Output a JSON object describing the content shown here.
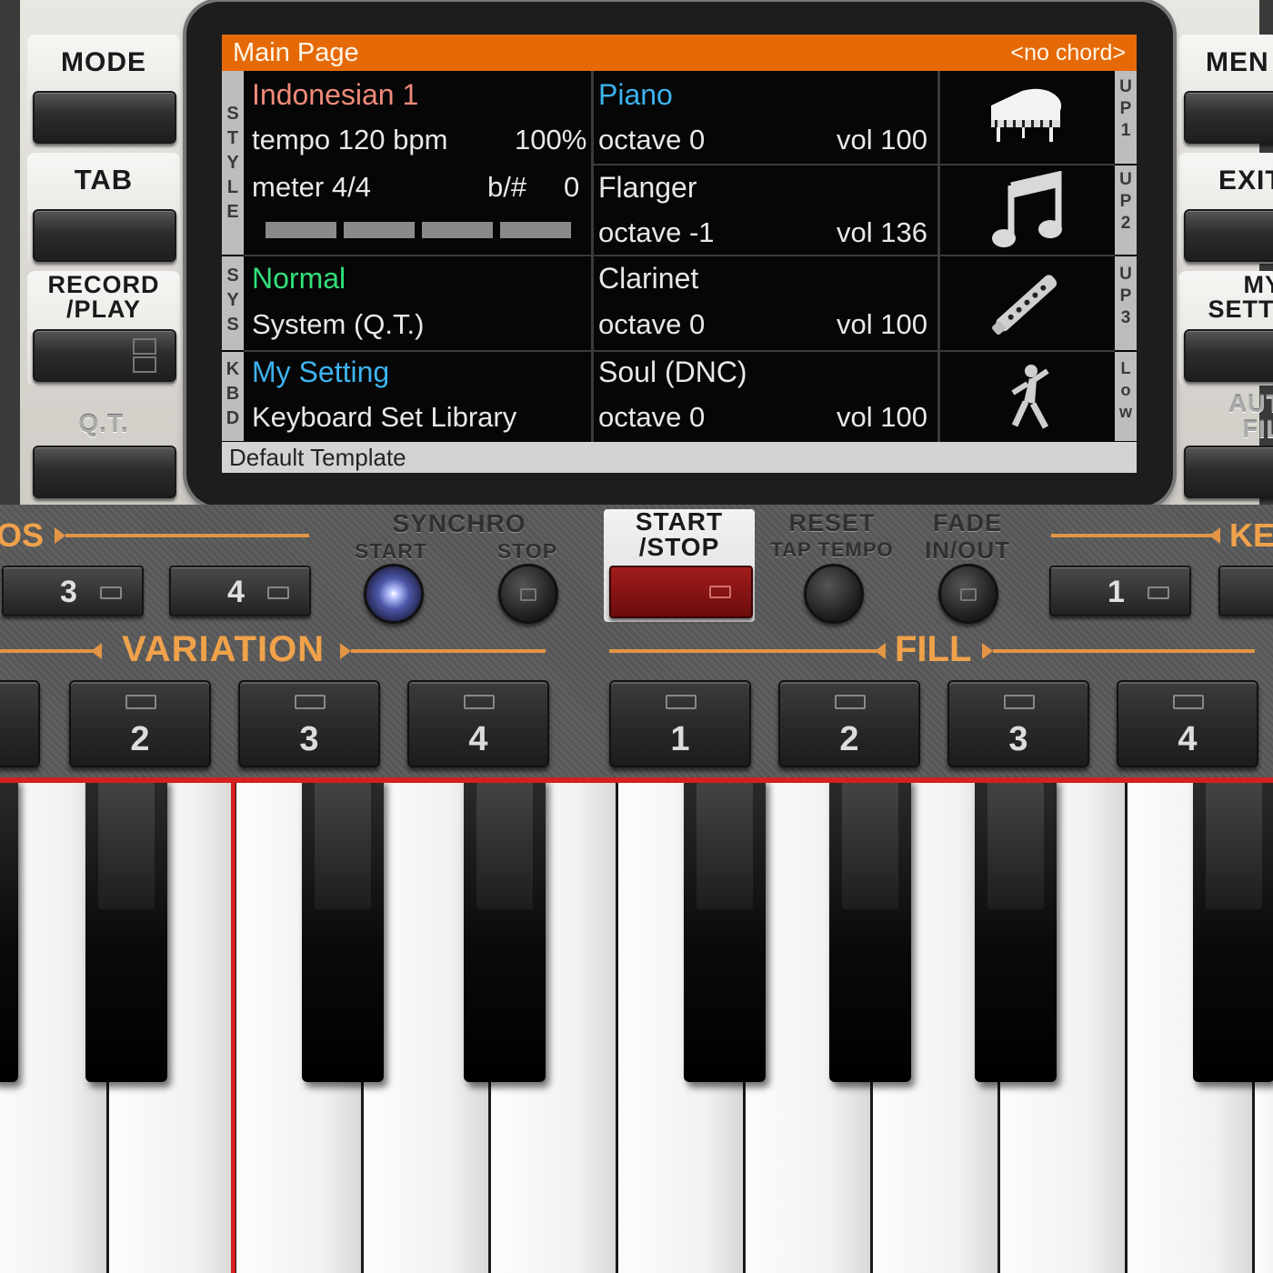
{
  "left_panel": {
    "mode_label": "MODE",
    "tab_label": "TAB",
    "record_label": "RECORD\n/PLAY",
    "qt_label": "Q.T."
  },
  "right_panel": {
    "menu_label": "MEN",
    "exit_label": "EXIT",
    "my_setting_label": "MY\nSETTI",
    "auto_fill_label": "AUT\nFIL"
  },
  "screen": {
    "title": "Main Page",
    "chord": "<no chord>",
    "left_vertical_labels": {
      "style": "STYLE",
      "sys": "SYS",
      "kbd": "KBD"
    },
    "right_vertical_labels": {
      "up1": "UP1",
      "up2": "UP2",
      "up3": "UP3",
      "low": "Low"
    },
    "style": {
      "name": "Indonesian 1",
      "tempo": "tempo 120 bpm",
      "tempo_pct": "100%",
      "meter": "meter 4/4",
      "key": "b/#",
      "key_value": "0"
    },
    "system": {
      "mode": "Normal",
      "detail": "System (Q.T.)"
    },
    "keyboard_set": {
      "name": "My Setting",
      "library": "Keyboard Set Library"
    },
    "parts": [
      {
        "name": "Piano",
        "octave": "octave  0",
        "vol": "vol 100",
        "icon": "piano-icon",
        "color": "#3db3ef"
      },
      {
        "name": "Flanger",
        "octave": "octave -1",
        "vol": "vol 136",
        "icon": "music-note-icon",
        "color": "#e8e8e8"
      },
      {
        "name": "Clarinet",
        "octave": "octave  0",
        "vol": "vol 100",
        "icon": "clarinet-icon",
        "color": "#e8e8e8"
      },
      {
        "name": "Soul (DNC)",
        "octave": "octave  0",
        "vol": "vol 100",
        "icon": "dancer-icon",
        "color": "#e8e8e8"
      }
    ],
    "footer": "Default Template",
    "colors": {
      "title_bar": "#e56a07",
      "style_name": "#f08a7a",
      "normal": "#31e07a",
      "my_setting": "#3db3ef"
    }
  },
  "controls": {
    "intros_label": "OS",
    "intro_buttons": [
      "3",
      "4"
    ],
    "synchro_label": "SYNCHRO",
    "synchro_start": "START",
    "synchro_stop": "STOP",
    "start_stop_label": "START\n/STOP",
    "reset_label": "RESET",
    "tap_tempo_label": "TAP TEMPO",
    "fade_label": "FADE",
    "fade_inout_label": "IN/OUT",
    "endings_label": "KE",
    "ending_buttons": [
      "1"
    ],
    "variation_label": "VARIATION",
    "variation_buttons": [
      "2",
      "3",
      "4"
    ],
    "fill_label": "FILL",
    "fill_buttons": [
      "1",
      "2",
      "3",
      "4"
    ]
  }
}
